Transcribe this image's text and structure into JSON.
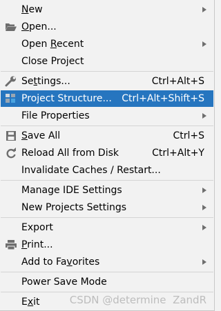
{
  "menu": {
    "items": [
      {
        "id": "new",
        "pre": "",
        "u": "N",
        "post": "ew",
        "shortcut": "",
        "submenu": true,
        "icon": ""
      },
      {
        "id": "open",
        "pre": "",
        "u": "O",
        "post": "pen...",
        "shortcut": "",
        "submenu": false,
        "icon": "folder-open-icon"
      },
      {
        "id": "open-recent",
        "pre": "Open ",
        "u": "R",
        "post": "ecent",
        "shortcut": "",
        "submenu": true,
        "icon": ""
      },
      {
        "id": "close-project",
        "pre": "Close Project",
        "u": "",
        "post": "",
        "shortcut": "",
        "submenu": false,
        "icon": ""
      },
      {
        "id": "settings",
        "pre": "Se",
        "u": "t",
        "post": "tings...",
        "shortcut": "Ctrl+Alt+S",
        "submenu": false,
        "icon": "wrench-icon"
      },
      {
        "id": "project-structure",
        "pre": "Project Structure...",
        "u": "",
        "post": "",
        "shortcut": "Ctrl+Alt+Shift+S",
        "submenu": false,
        "icon": "project-structure-icon",
        "selected": true
      },
      {
        "id": "file-properties",
        "pre": "File Properties",
        "u": "",
        "post": "",
        "shortcut": "",
        "submenu": true,
        "icon": ""
      },
      {
        "id": "save-all",
        "pre": "",
        "u": "S",
        "post": "ave All",
        "shortcut": "Ctrl+S",
        "submenu": false,
        "icon": "save-icon"
      },
      {
        "id": "reload-all",
        "pre": "Reload All from Disk",
        "u": "",
        "post": "",
        "shortcut": "Ctrl+Alt+Y",
        "submenu": false,
        "icon": "reload-icon"
      },
      {
        "id": "invalidate-caches",
        "pre": "Invalidate Caches / Restart...",
        "u": "",
        "post": "",
        "shortcut": "",
        "submenu": false,
        "icon": ""
      },
      {
        "id": "manage-ide-settings",
        "pre": "Manage IDE Settings",
        "u": "",
        "post": "",
        "shortcut": "",
        "submenu": true,
        "icon": ""
      },
      {
        "id": "new-projects-settings",
        "pre": "New Projects Settings",
        "u": "",
        "post": "",
        "shortcut": "",
        "submenu": true,
        "icon": ""
      },
      {
        "id": "export",
        "pre": "Export",
        "u": "",
        "post": "",
        "shortcut": "",
        "submenu": true,
        "icon": ""
      },
      {
        "id": "print",
        "pre": "",
        "u": "P",
        "post": "rint...",
        "shortcut": "",
        "submenu": false,
        "icon": "printer-icon"
      },
      {
        "id": "add-to-favorites",
        "pre": "Add to Fa",
        "u": "v",
        "post": "orites",
        "shortcut": "",
        "submenu": true,
        "icon": ""
      },
      {
        "id": "power-save-mode",
        "pre": "Power Save Mode",
        "u": "",
        "post": "",
        "shortcut": "",
        "submenu": false,
        "icon": ""
      },
      {
        "id": "exit",
        "pre": "E",
        "u": "x",
        "post": "it",
        "shortcut": "",
        "submenu": false,
        "icon": ""
      }
    ]
  },
  "watermark": "CSDN @determine  ZandR",
  "colors": {
    "selection": "#2675bf",
    "background": "#f2f2f2",
    "separator": "#d4d4d4"
  }
}
